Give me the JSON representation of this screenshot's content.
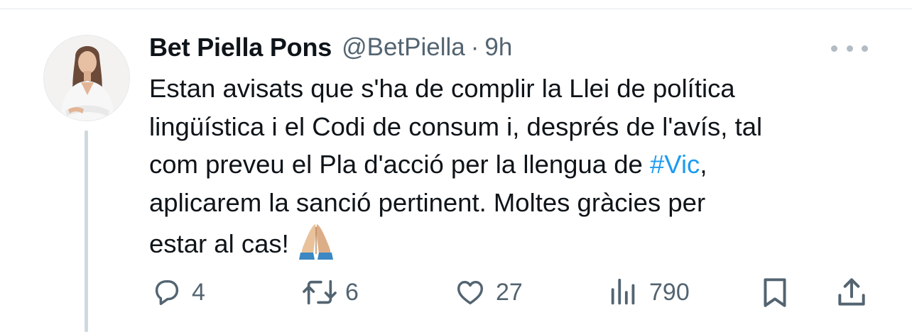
{
  "tweet": {
    "author_name": "Bet Piella Pons",
    "author_handle": "@BetPiella",
    "separator": "·",
    "time": "9h",
    "text_lines": [
      "Estan avisats que s'ha de complir la Llei de política",
      "lingüística i el Codi de consum i, després de l'avís, tal",
      "com preveu el Pla d'acció per la llengua de ",
      "aplicarem la sanció pertinent. Moltes gràcies per",
      "estar al cas!"
    ],
    "hashtag": "#Vic",
    "after_hashtag": ",",
    "emoji": "folded-hands-emoji",
    "hashtag_color": "#1d9bf0"
  },
  "actions": {
    "reply_count": "4",
    "retweet_count": "6",
    "like_count": "27",
    "views_count": "790"
  },
  "icons": {
    "reply": "reply-icon",
    "retweet": "retweet-icon",
    "like": "heart-icon",
    "views": "views-icon",
    "bookmark": "bookmark-icon",
    "share": "share-icon",
    "more": "more-icon"
  },
  "colors": {
    "text": "#0f1419",
    "secondary": "#536471",
    "accent": "#1d9bf0",
    "thread_line": "#cfd9de"
  }
}
